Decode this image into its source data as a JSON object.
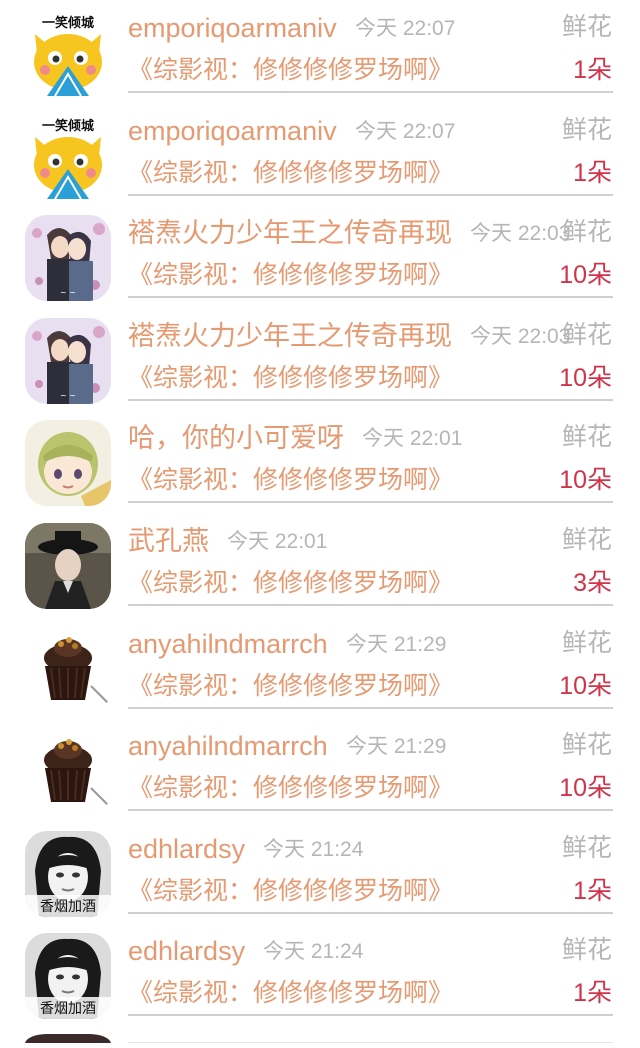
{
  "gift_list": {
    "items": [
      {
        "avatar": "cat-avatar-icon",
        "avatar_caption": "一笑倾城",
        "name": "emporiqoarmaniv",
        "time": "今天 22:07",
        "gift": "鲜花",
        "book": "《综影视：修修修修罗场啊》",
        "count": "1朵"
      },
      {
        "avatar": "cat-avatar-icon",
        "avatar_caption": "一笑倾城",
        "name": "emporiqoarmaniv",
        "time": "今天 22:07",
        "gift": "鲜花",
        "book": "《综影视：修修修修罗场啊》",
        "count": "1朵"
      },
      {
        "avatar": "anime-couple-avatar-icon",
        "avatar_caption": "",
        "name": "褡焘火力少年王之传奇再现",
        "time": "今天 22:03",
        "gift": "鲜花",
        "book": "《综影视：修修修修罗场啊》",
        "count": "10朵"
      },
      {
        "avatar": "anime-couple-avatar-icon",
        "avatar_caption": "",
        "name": "褡焘火力少年王之传奇再现",
        "time": "今天 22:03",
        "gift": "鲜花",
        "book": "《综影视：修修修修罗场啊》",
        "count": "10朵"
      },
      {
        "avatar": "anime-child-avatar-icon",
        "avatar_caption": "",
        "name": "哈，你的小可爱呀",
        "time": "今天 22:01",
        "gift": "鲜花",
        "book": "《综影视：修修修修罗场啊》",
        "count": "10朵"
      },
      {
        "avatar": "costume-actor-avatar-icon",
        "avatar_caption": "",
        "name": "武孔燕",
        "time": "今天 22:01",
        "gift": "鲜花",
        "book": "《综影视：修修修修罗场啊》",
        "count": "3朵"
      },
      {
        "avatar": "cupcake-avatar-icon",
        "avatar_caption": "",
        "name": "anyahilndmarrch",
        "time": "今天 21:29",
        "gift": "鲜花",
        "book": "《综影视：修修修修罗场啊》",
        "count": "10朵"
      },
      {
        "avatar": "cupcake-avatar-icon",
        "avatar_caption": "",
        "name": "anyahilndmarrch",
        "time": "今天 21:29",
        "gift": "鲜花",
        "book": "《综影视：修修修修罗场啊》",
        "count": "10朵"
      },
      {
        "avatar": "bw-portrait-avatar-icon",
        "avatar_caption": "香烟加酒",
        "name": "edhlardsy",
        "time": "今天 21:24",
        "gift": "鲜花",
        "book": "《综影视：修修修修罗场啊》",
        "count": "1朵"
      },
      {
        "avatar": "bw-portrait-avatar-icon",
        "avatar_caption": "香烟加酒",
        "name": "edhlardsy",
        "time": "今天 21:24",
        "gift": "鲜花",
        "book": "《综影视：修修修修罗场啊》",
        "count": "1朵"
      }
    ]
  },
  "colors": {
    "name": "#e59a72",
    "book": "#e59a72",
    "count": "#d0344b",
    "muted": "#b6b6b6",
    "divider": "#cfcfcf"
  }
}
